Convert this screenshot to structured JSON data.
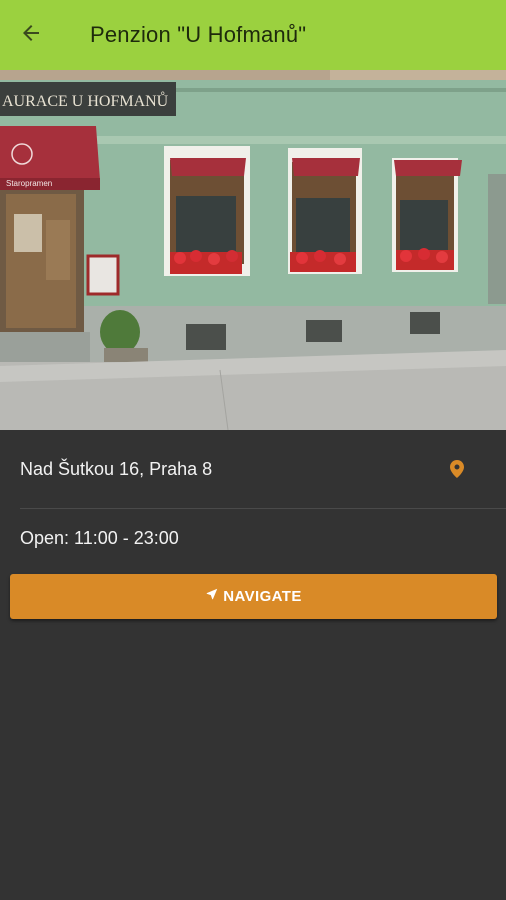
{
  "colors": {
    "appbar": "#9bd13f",
    "background": "#333333",
    "navigate_button": "#d98a27",
    "pin": "#d98a27"
  },
  "appbar": {
    "back_icon": "arrow-left-icon",
    "title": "Penzion \"U Hofmanů\""
  },
  "photo": {
    "sign_text": "AURACE U HOFMANŮ",
    "awning_text": "Staropramen"
  },
  "details": {
    "address": "Nad Šutkou 16, Praha 8",
    "address_icon": "map-pin-icon",
    "hours": "Open: 11:00 - 23:00"
  },
  "navigate": {
    "icon": "navigation-arrow-icon",
    "label": "NAVIGATE"
  }
}
